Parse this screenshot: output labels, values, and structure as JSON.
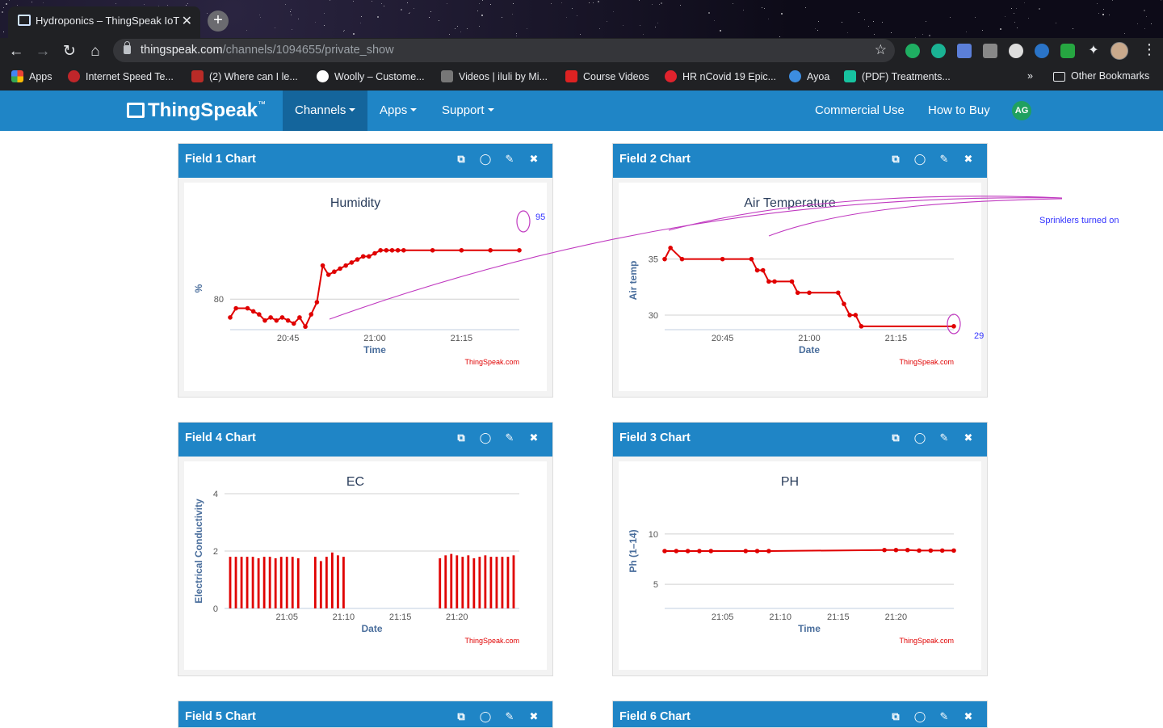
{
  "browser": {
    "tab_title": "Hydroponics – ThingSpeak IoT",
    "url_host": "thingspeak.com",
    "url_path": "/channels/1094655/private_show",
    "bookmarks": [
      "Apps",
      "Internet Speed Te...",
      "(2) Where can I le...",
      "Woolly – Custome...",
      "Videos | iluli by Mi...",
      "Course Videos",
      "HR nCovid 19 Epic...",
      "Ayoa",
      "(PDF) Treatments...",
      "Other Bookmarks"
    ]
  },
  "header": {
    "logo": "ThingSpeak",
    "logo_tm": "™",
    "nav": [
      "Channels",
      "Apps",
      "Support"
    ],
    "right_links": [
      "Commercial Use",
      "How to Buy"
    ],
    "user_initials": "AG"
  },
  "panels": {
    "p1": {
      "title": "Field 1 Chart"
    },
    "p2": {
      "title": "Field 2 Chart"
    },
    "p4": {
      "title": "Field 4 Chart"
    },
    "p3": {
      "title": "Field 3 Chart"
    },
    "p5": {
      "title": "Field 5 Chart"
    },
    "p6": {
      "title": "Field 6 Chart"
    }
  },
  "annotations": {
    "humidity_value": "95",
    "air_temp_value": "29",
    "note": "Sprinklers turned on"
  },
  "colors": {
    "brand_blue": "#1f85c6",
    "series_red": "#e00000",
    "annotation_purple": "#c03ac0",
    "annotation_blue": "#3333ff"
  },
  "chart_data": [
    {
      "type": "line",
      "title": "Humidity",
      "xlabel": "Time",
      "ylabel": "%",
      "x_ticks": [
        "20:45",
        "21:00",
        "21:15"
      ],
      "y_ticks": [
        80
      ],
      "credit": "ThingSpeak.com",
      "x": [
        "20:35",
        "20:36",
        "20:38",
        "20:39",
        "20:40",
        "20:41",
        "20:42",
        "20:43",
        "20:44",
        "20:45",
        "20:46",
        "20:47",
        "20:48",
        "20:49",
        "20:50",
        "20:51",
        "20:52",
        "20:53",
        "20:54",
        "20:55",
        "20:56",
        "20:57",
        "20:58",
        "20:59",
        "21:00",
        "21:01",
        "21:02",
        "21:03",
        "21:04",
        "21:05",
        "21:10",
        "21:15",
        "21:20",
        "21:25"
      ],
      "values": [
        74,
        77,
        77,
        76,
        75,
        73,
        74,
        73,
        74,
        73,
        72,
        74,
        71,
        75,
        79,
        91,
        88,
        89,
        90,
        91,
        92,
        93,
        94,
        94,
        95,
        96,
        96,
        96,
        96,
        96,
        96,
        96,
        96,
        96
      ]
    },
    {
      "type": "line",
      "title": "Air Temperature",
      "xlabel": "Date",
      "ylabel": "Air temp",
      "x_ticks": [
        "20:45",
        "21:00",
        "21:15"
      ],
      "y_ticks": [
        30,
        35
      ],
      "credit": "ThingSpeak.com",
      "x": [
        "20:35",
        "20:36",
        "20:38",
        "20:45",
        "20:50",
        "20:51",
        "20:52",
        "20:53",
        "20:54",
        "20:57",
        "20:58",
        "21:00",
        "21:05",
        "21:06",
        "21:07",
        "21:08",
        "21:09",
        "21:25"
      ],
      "values": [
        35,
        36,
        35,
        35,
        35,
        34,
        34,
        33,
        33,
        33,
        32,
        32,
        32,
        31,
        30,
        30,
        29,
        29
      ]
    },
    {
      "type": "bar",
      "title": "EC",
      "xlabel": "Date",
      "ylabel": "Electrical Conductivity",
      "x_ticks": [
        "21:05",
        "21:10",
        "21:15",
        "21:20"
      ],
      "y_ticks": [
        0,
        2,
        4
      ],
      "credit": "ThingSpeak.com",
      "series": [
        {
          "x": [
            "21:00",
            "21:00.5",
            "21:01",
            "21:01.5",
            "21:02",
            "21:02.5",
            "21:03",
            "21:03.5",
            "21:04",
            "21:04.5",
            "21:05",
            "21:05.5",
            "21:06",
            "21:07.5",
            "21:08",
            "21:08.5",
            "21:09",
            "21:09.5",
            "21:10",
            "21:18.5",
            "21:19",
            "21:19.5",
            "21:20",
            "21:20.5",
            "21:21",
            "21:21.5",
            "21:22",
            "21:22.5",
            "21:23",
            "21:23.5",
            "21:24",
            "21:24.5",
            "21:25"
          ],
          "values": [
            1.8,
            1.8,
            1.8,
            1.8,
            1.8,
            1.75,
            1.8,
            1.8,
            1.75,
            1.8,
            1.8,
            1.8,
            1.75,
            1.8,
            1.65,
            1.8,
            1.95,
            1.85,
            1.8,
            1.75,
            1.85,
            1.9,
            1.85,
            1.8,
            1.85,
            1.75,
            1.8,
            1.85,
            1.8,
            1.8,
            1.8,
            1.8,
            1.85
          ]
        }
      ]
    },
    {
      "type": "line",
      "title": "PH",
      "xlabel": "Time",
      "ylabel": "Ph (1–14)",
      "x_ticks": [
        "21:05",
        "21:10",
        "21:15",
        "21:20"
      ],
      "y_ticks": [
        5,
        10
      ],
      "credit": "ThingSpeak.com",
      "x": [
        "21:00",
        "21:01",
        "21:02",
        "21:03",
        "21:04",
        "21:07",
        "21:08",
        "21:09",
        "21:19",
        "21:20",
        "21:21",
        "21:22",
        "21:23",
        "21:24",
        "21:25"
      ],
      "values": [
        8.3,
        8.3,
        8.3,
        8.3,
        8.3,
        8.3,
        8.3,
        8.3,
        8.4,
        8.4,
        8.4,
        8.35,
        8.35,
        8.35,
        8.35
      ]
    }
  ]
}
